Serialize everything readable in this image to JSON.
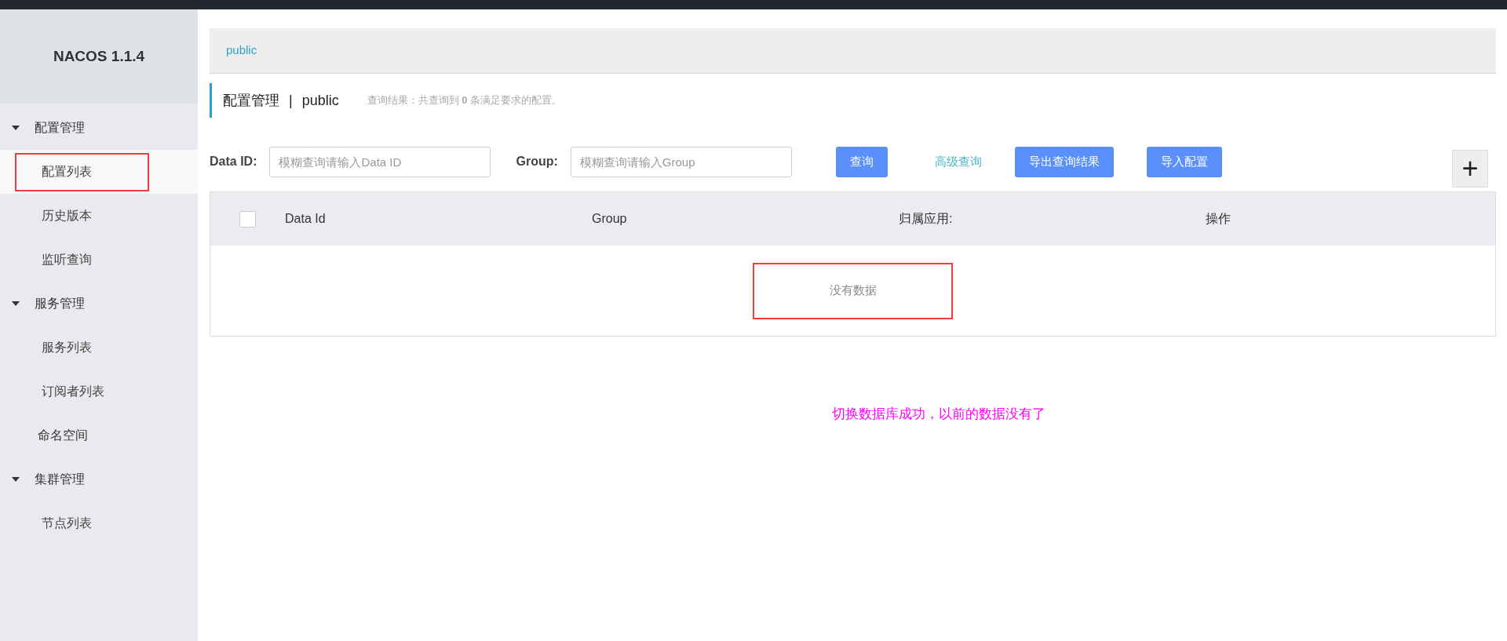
{
  "sidebar": {
    "title": "NACOS 1.1.4",
    "items": [
      {
        "label": "配置管理",
        "expanded": true,
        "children": [
          {
            "label": "配置列表",
            "selected": true,
            "marked": true
          },
          {
            "label": "历史版本",
            "selected": false,
            "marked": false
          },
          {
            "label": "监听查询",
            "selected": false,
            "marked": false
          }
        ]
      },
      {
        "label": "服务管理",
        "expanded": true,
        "children": [
          {
            "label": "服务列表",
            "selected": false,
            "marked": false
          },
          {
            "label": "订阅者列表",
            "selected": false,
            "marked": false
          }
        ]
      },
      {
        "label": "命名空间",
        "selected": false,
        "marked": false
      },
      {
        "label": "集群管理",
        "expanded": true,
        "children": [
          {
            "label": "节点列表",
            "selected": false,
            "marked": false
          }
        ]
      }
    ]
  },
  "namespace_bar": {
    "namespace": "public"
  },
  "header": {
    "title": "配置管理",
    "separator": "|",
    "namespace": "public",
    "result_text": "查询结果：共查询到 **0** 条满足要求的配置。"
  },
  "filters": [
    {
      "label": "Data ID:",
      "placeholder": "模糊查询请输入Data ID"
    },
    {
      "label": "Group:",
      "placeholder": "模糊查询请输入Group"
    }
  ],
  "actions": [
    {
      "kind": "button",
      "label": "查询"
    },
    {
      "kind": "link",
      "label": "高级查询"
    },
    {
      "kind": "button",
      "label": "导出查询结果"
    },
    {
      "kind": "button",
      "label": "导入配置"
    }
  ],
  "add_button": {
    "label": "+"
  },
  "table": {
    "select_all": {
      "checked": false
    },
    "columns": [
      "Data Id",
      "Group",
      "归属应用:",
      "操作"
    ],
    "empty_text": "没有数据",
    "empty_marked": true
  },
  "annotation": "切换数据库成功，以前的数据没有了"
}
